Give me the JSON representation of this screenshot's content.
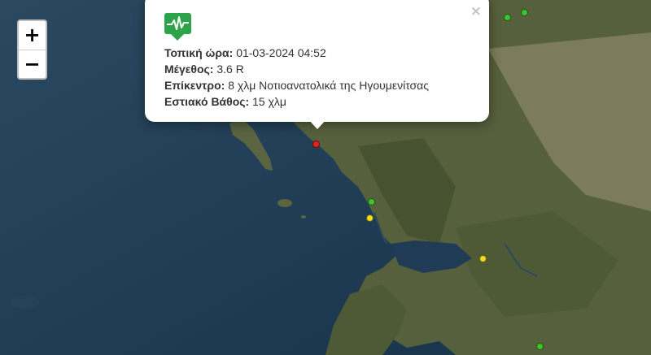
{
  "map": {
    "zoom": {
      "in_label": "+",
      "out_label": "−"
    },
    "popup": {
      "icon": "seismograph-icon",
      "close_label": "×",
      "fields": [
        {
          "label": "Τοπική ώρα:",
          "value": "01-03-2024 04:52"
        },
        {
          "label": "Μέγεθος:",
          "value": "3.6 R"
        },
        {
          "label": "Επίκεντρο:",
          "value": "8 χλμ Νοτιοανατολικά της Ηγουμενίτσας"
        },
        {
          "label": "Εστιακό Βάθος:",
          "value": "15 χλμ"
        }
      ]
    },
    "marker_colors": {
      "red": "#e8201c",
      "green": "#3fc32e",
      "yellow": "#f2da22"
    },
    "markers": [
      {
        "color": "red",
        "type": "selected earthquake"
      },
      {
        "color": "green"
      },
      {
        "color": "green"
      },
      {
        "color": "green"
      },
      {
        "color": "green"
      },
      {
        "color": "yellow"
      },
      {
        "color": "yellow"
      }
    ]
  }
}
